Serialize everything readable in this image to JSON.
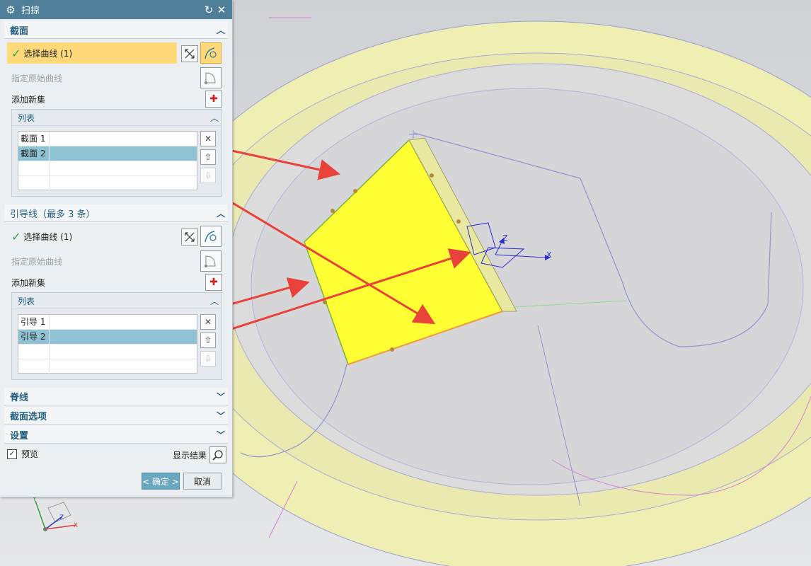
{
  "dialog": {
    "title": "扫掠",
    "reset_icon": "reset-icon",
    "close_icon": "close-icon",
    "sections": {
      "section": {
        "header": "截面",
        "select_curve": "选择曲线 (1)",
        "specify_origin": "指定原始曲线",
        "add_new_set": "添加新集",
        "list_header": "列表",
        "items": [
          "截面 1",
          "截面 2"
        ],
        "selected_index": 1
      },
      "guide": {
        "header": "引导线（最多 3 条）",
        "select_curve": "选择曲线 (1)",
        "specify_origin": "指定原始曲线",
        "add_new_set": "添加新集",
        "list_header": "列表",
        "items": [
          "引导 1",
          "引导 2"
        ],
        "selected_index": 1
      },
      "spine": {
        "header": "脊线"
      },
      "section_options": {
        "header": "截面选项"
      },
      "settings": {
        "header": "设置"
      }
    },
    "preview": {
      "label": "预览",
      "checked": true
    },
    "show_result": "显示结果",
    "ok_button": "< 确定 >",
    "cancel_button": "取消"
  },
  "triad": {
    "x": "X",
    "y": "Y",
    "z": "Z"
  },
  "csys": {
    "x": "X",
    "z": "Z"
  },
  "colors": {
    "title_bar": "#4f7f98",
    "section_header": "#24607f",
    "highlight_row": "#ffd97a",
    "list_selected": "#8fc2d3",
    "face_yellow": "#ffff33",
    "ring_yellow": "#efefb4",
    "annotation_arrow": "#e8423a"
  }
}
